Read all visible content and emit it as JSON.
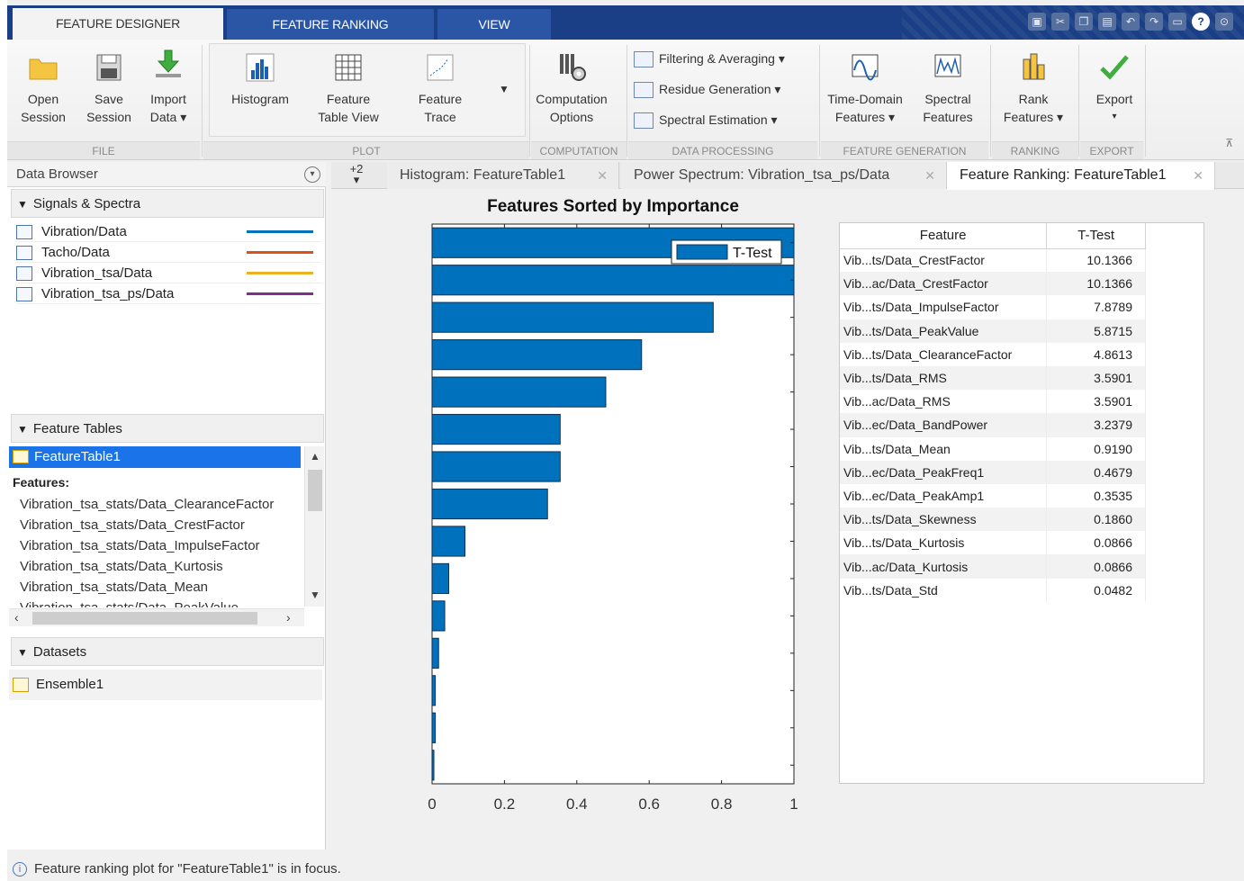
{
  "tabs": [
    {
      "label": "FEATURE DESIGNER",
      "active": true
    },
    {
      "label": "FEATURE RANKING",
      "active": false
    },
    {
      "label": "VIEW",
      "active": false
    }
  ],
  "ribbon": {
    "file": {
      "group": "FILE",
      "open_line1": "Open",
      "open_line2": "Session",
      "save_line1": "Save",
      "save_line2": "Session",
      "import_line1": "Import",
      "import_line2": "Data ▾"
    },
    "plot": {
      "group": "PLOT",
      "histogram": "Histogram",
      "feature_table_line1": "Feature",
      "feature_table_line2": "Table View",
      "feature_trace_line1": "Feature",
      "feature_trace_line2": "Trace"
    },
    "computation": {
      "group": "COMPUTATION",
      "options_line1": "Computation",
      "options_line2": "Options"
    },
    "data_processing": {
      "group": "DATA PROCESSING",
      "filtering": "Filtering & Averaging ▾",
      "residue": "Residue Generation ▾",
      "spectral": "Spectral Estimation ▾"
    },
    "feature_generation": {
      "group": "FEATURE GENERATION",
      "time_domain_line1": "Time-Domain",
      "time_domain_line2": "Features ▾",
      "spectral_line1": "Spectral",
      "spectral_line2": "Features"
    },
    "ranking": {
      "group": "RANKING",
      "rank_line1": "Rank",
      "rank_line2": "Features ▾"
    },
    "export": {
      "group": "EXPORT",
      "label": "Export",
      "caret": "▾"
    }
  },
  "data_browser": {
    "title": "Data Browser",
    "signals_header": "Signals & Spectra",
    "signals": [
      {
        "name": "Vibration/Data",
        "color": "#0072bd"
      },
      {
        "name": "Tacho/Data",
        "color": "#d95319"
      },
      {
        "name": "Vibration_tsa/Data",
        "color": "#edb120"
      },
      {
        "name": "Vibration_tsa_ps/Data",
        "color": "#7e2f8e"
      }
    ],
    "feature_tables_header": "Feature Tables",
    "selected_table": "FeatureTable1",
    "features_label": "Features:",
    "features": [
      "Vibration_tsa_stats/Data_ClearanceFactor",
      "Vibration_tsa_stats/Data_CrestFactor",
      "Vibration_tsa_stats/Data_ImpulseFactor",
      "Vibration_tsa_stats/Data_Kurtosis",
      "Vibration_tsa_stats/Data_Mean",
      "Vibration_tsa_stats/Data_PeakValue"
    ],
    "datasets_header": "Datasets",
    "dataset": "Ensemble1"
  },
  "doc_tabs": {
    "more": "+2",
    "tabs": [
      {
        "label": "Histogram: FeatureTable1",
        "active": false
      },
      {
        "label": "Power Spectrum: Vibration_tsa_ps/Data",
        "active": false
      },
      {
        "label": "Feature Ranking: FeatureTable1",
        "active": true
      }
    ]
  },
  "chart_data": {
    "type": "bar",
    "orientation": "horizontal",
    "title": "Features Sorted by Importance",
    "legend": [
      "T-Test"
    ],
    "legend_position": "top-right",
    "xlim": [
      0,
      1
    ],
    "xticks": [
      "0",
      "0.2",
      "0.4",
      "0.6",
      "0.8",
      "1"
    ],
    "values": [
      1.0,
      1.0,
      0.777,
      0.579,
      0.48,
      0.354,
      0.354,
      0.319,
      0.091,
      0.046,
      0.035,
      0.018,
      0.009,
      0.009,
      0.005
    ],
    "bar_color": "#0072bd"
  },
  "ranking_table": {
    "headers": [
      "Feature",
      "T-Test"
    ],
    "rows": [
      [
        "Vib...ts/Data_CrestFactor",
        "10.1366"
      ],
      [
        "Vib...ac/Data_CrestFactor",
        "10.1366"
      ],
      [
        "Vib...ts/Data_ImpulseFactor",
        "7.8789"
      ],
      [
        "Vib...ts/Data_PeakValue",
        "5.8715"
      ],
      [
        "Vib...ts/Data_ClearanceFactor",
        "4.8613"
      ],
      [
        "Vib...ts/Data_RMS",
        "3.5901"
      ],
      [
        "Vib...ac/Data_RMS",
        "3.5901"
      ],
      [
        "Vib...ec/Data_BandPower",
        "3.2379"
      ],
      [
        "Vib...ts/Data_Mean",
        "0.9190"
      ],
      [
        "Vib...ec/Data_PeakFreq1",
        "0.4679"
      ],
      [
        "Vib...ec/Data_PeakAmp1",
        "0.3535"
      ],
      [
        "Vib...ts/Data_Skewness",
        "0.1860"
      ],
      [
        "Vib...ts/Data_Kurtosis",
        "0.0866"
      ],
      [
        "Vib...ac/Data_Kurtosis",
        "0.0866"
      ],
      [
        "Vib...ts/Data_Std",
        "0.0482"
      ]
    ]
  },
  "status": "Feature ranking plot for \"FeatureTable1\" is in focus."
}
